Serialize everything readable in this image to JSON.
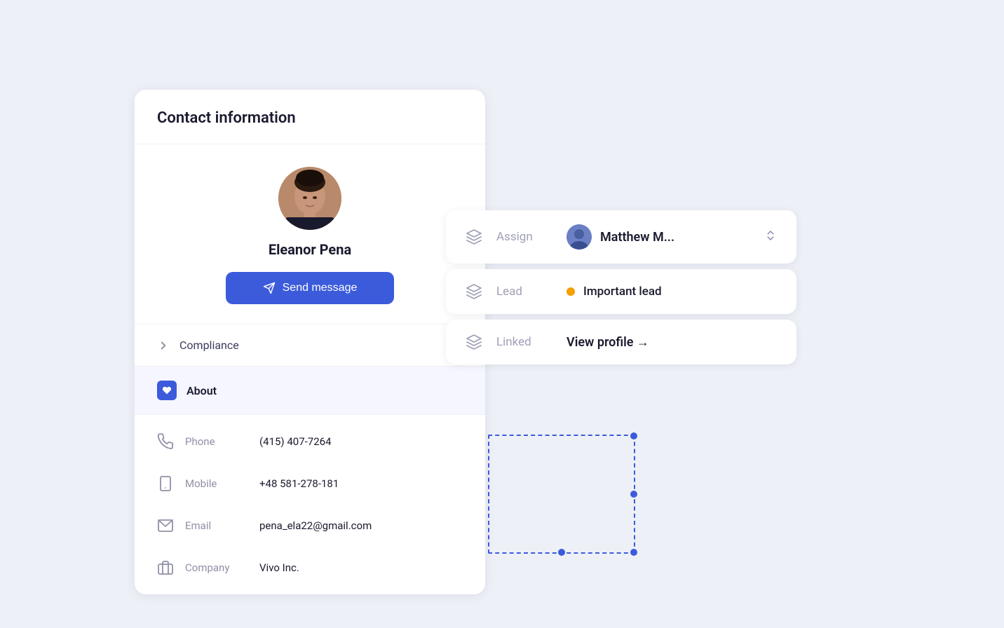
{
  "contactCard": {
    "title": "Contact information",
    "name": "Eleanor Pena",
    "sendMessageLabel": "Send message",
    "sections": {
      "compliance": "Compliance",
      "about": "About"
    },
    "fields": [
      {
        "icon": "phone",
        "label": "Phone",
        "value": "(415) 407-7264"
      },
      {
        "icon": "mobile",
        "label": "Mobile",
        "value": "+48 581-278-181"
      },
      {
        "icon": "email",
        "label": "Email",
        "value": "pena_ela22@gmail.com"
      },
      {
        "icon": "company",
        "label": "Company",
        "value": "Vivo Inc."
      }
    ]
  },
  "rightPanel": {
    "assign": {
      "sectionLabel": "Assign",
      "assigneeName": "Matthew M...",
      "icon": "layers"
    },
    "lead": {
      "sectionLabel": "Lead",
      "value": "Important lead",
      "dotColor": "#f59f00",
      "icon": "layers"
    },
    "linked": {
      "sectionLabel": "Linked",
      "linkLabel": "View profile →",
      "icon": "layers"
    }
  }
}
